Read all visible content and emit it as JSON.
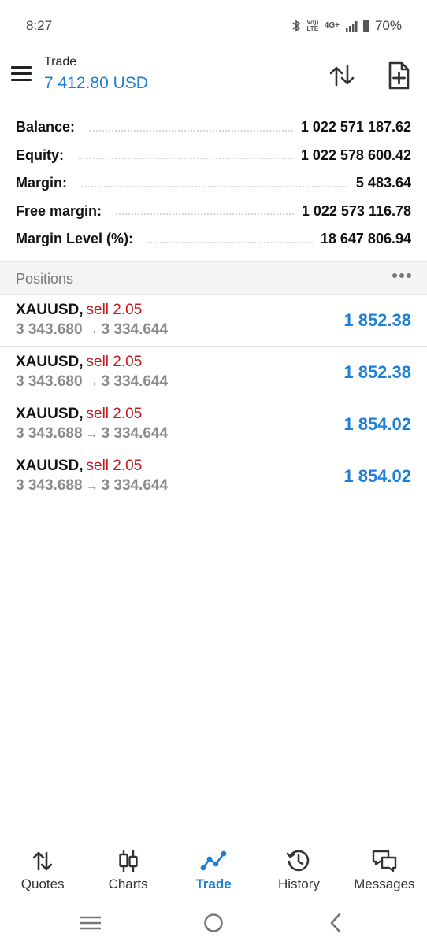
{
  "status_bar": {
    "time": "8:27",
    "network": "4G+",
    "volte": "Vo)) LTE",
    "battery": "70%"
  },
  "header": {
    "title": "Trade",
    "value": "7 412.80 USD"
  },
  "summary": [
    {
      "label": "Balance:",
      "value": "1 022 571 187.62"
    },
    {
      "label": "Equity:",
      "value": "1 022 578 600.42"
    },
    {
      "label": "Margin:",
      "value": "5 483.64"
    },
    {
      "label": "Free margin:",
      "value": "1 022 573 116.78"
    },
    {
      "label": "Margin Level (%):",
      "value": "18 647 806.94"
    }
  ],
  "positions": {
    "title": "Positions",
    "items": [
      {
        "symbol": "XAUUSD",
        "side": "sell 2.05",
        "open": "3 343.680",
        "current": "3 334.644",
        "profit": "1 852.38"
      },
      {
        "symbol": "XAUUSD",
        "side": "sell 2.05",
        "open": "3 343.680",
        "current": "3 334.644",
        "profit": "1 852.38"
      },
      {
        "symbol": "XAUUSD",
        "side": "sell 2.05",
        "open": "3 343.688",
        "current": "3 334.644",
        "profit": "1 854.02"
      },
      {
        "symbol": "XAUUSD",
        "side": "sell 2.05",
        "open": "3 343.688",
        "current": "3 334.644",
        "profit": "1 854.02"
      }
    ]
  },
  "nav": [
    {
      "label": "Quotes",
      "icon": "quotes-icon"
    },
    {
      "label": "Charts",
      "icon": "charts-icon"
    },
    {
      "label": "Trade",
      "icon": "trade-icon"
    },
    {
      "label": "History",
      "icon": "history-icon"
    },
    {
      "label": "Messages",
      "icon": "messages-icon"
    }
  ],
  "active_nav": "Trade",
  "colors": {
    "accent": "#1e7fd6",
    "sell": "#c8181e",
    "muted": "#8a8a8a"
  }
}
